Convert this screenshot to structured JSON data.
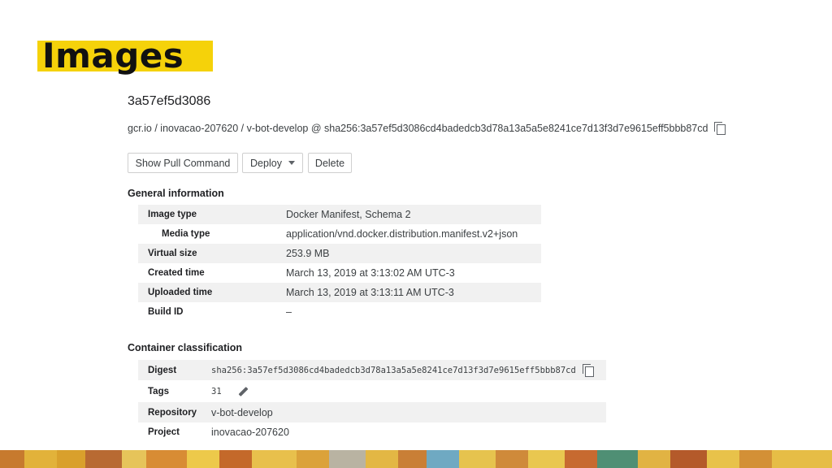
{
  "slide": {
    "title": "Images"
  },
  "image": {
    "id": "3a57ef5d3086",
    "breadcrumb": "gcr.io / inovacao-207620 / v-bot-develop @ sha256:3a57ef5d3086cd4badedcb3d78a13a5a5e8241ce7d13f3d7e9615eff5bbb87cd"
  },
  "toolbar": {
    "show_pull_command": "Show Pull Command",
    "deploy": "Deploy",
    "delete": "Delete"
  },
  "general": {
    "heading": "General information",
    "rows": [
      {
        "key": "Image type",
        "value": "Docker Manifest, Schema 2"
      },
      {
        "key": "Media type",
        "value": "application/vnd.docker.distribution.manifest.v2+json"
      },
      {
        "key": "Virtual size",
        "value": "253.9 MB"
      },
      {
        "key": "Created time",
        "value": "March 13, 2019 at 3:13:02 AM UTC-3"
      },
      {
        "key": "Uploaded time",
        "value": "March 13, 2019 at 3:13:11 AM UTC-3"
      },
      {
        "key": "Build ID",
        "value": "–"
      }
    ]
  },
  "classification": {
    "heading": "Container classification",
    "digest_label": "Digest",
    "digest": "sha256:3a57ef5d3086cd4badedcb3d78a13a5a5e8241ce7d13f3d7e9615eff5bbb87cd",
    "tags_label": "Tags",
    "tags": "31",
    "repository_label": "Repository",
    "repository": "v-bot-develop",
    "project_label": "Project",
    "project": "inovacao-207620"
  },
  "colors": {
    "title_highlight": "#f5d20a",
    "row_shade": "#f1f1f1",
    "text": "#3c4043"
  },
  "icons": [
    "copy-icon",
    "chevron-down-icon",
    "pencil-icon"
  ]
}
